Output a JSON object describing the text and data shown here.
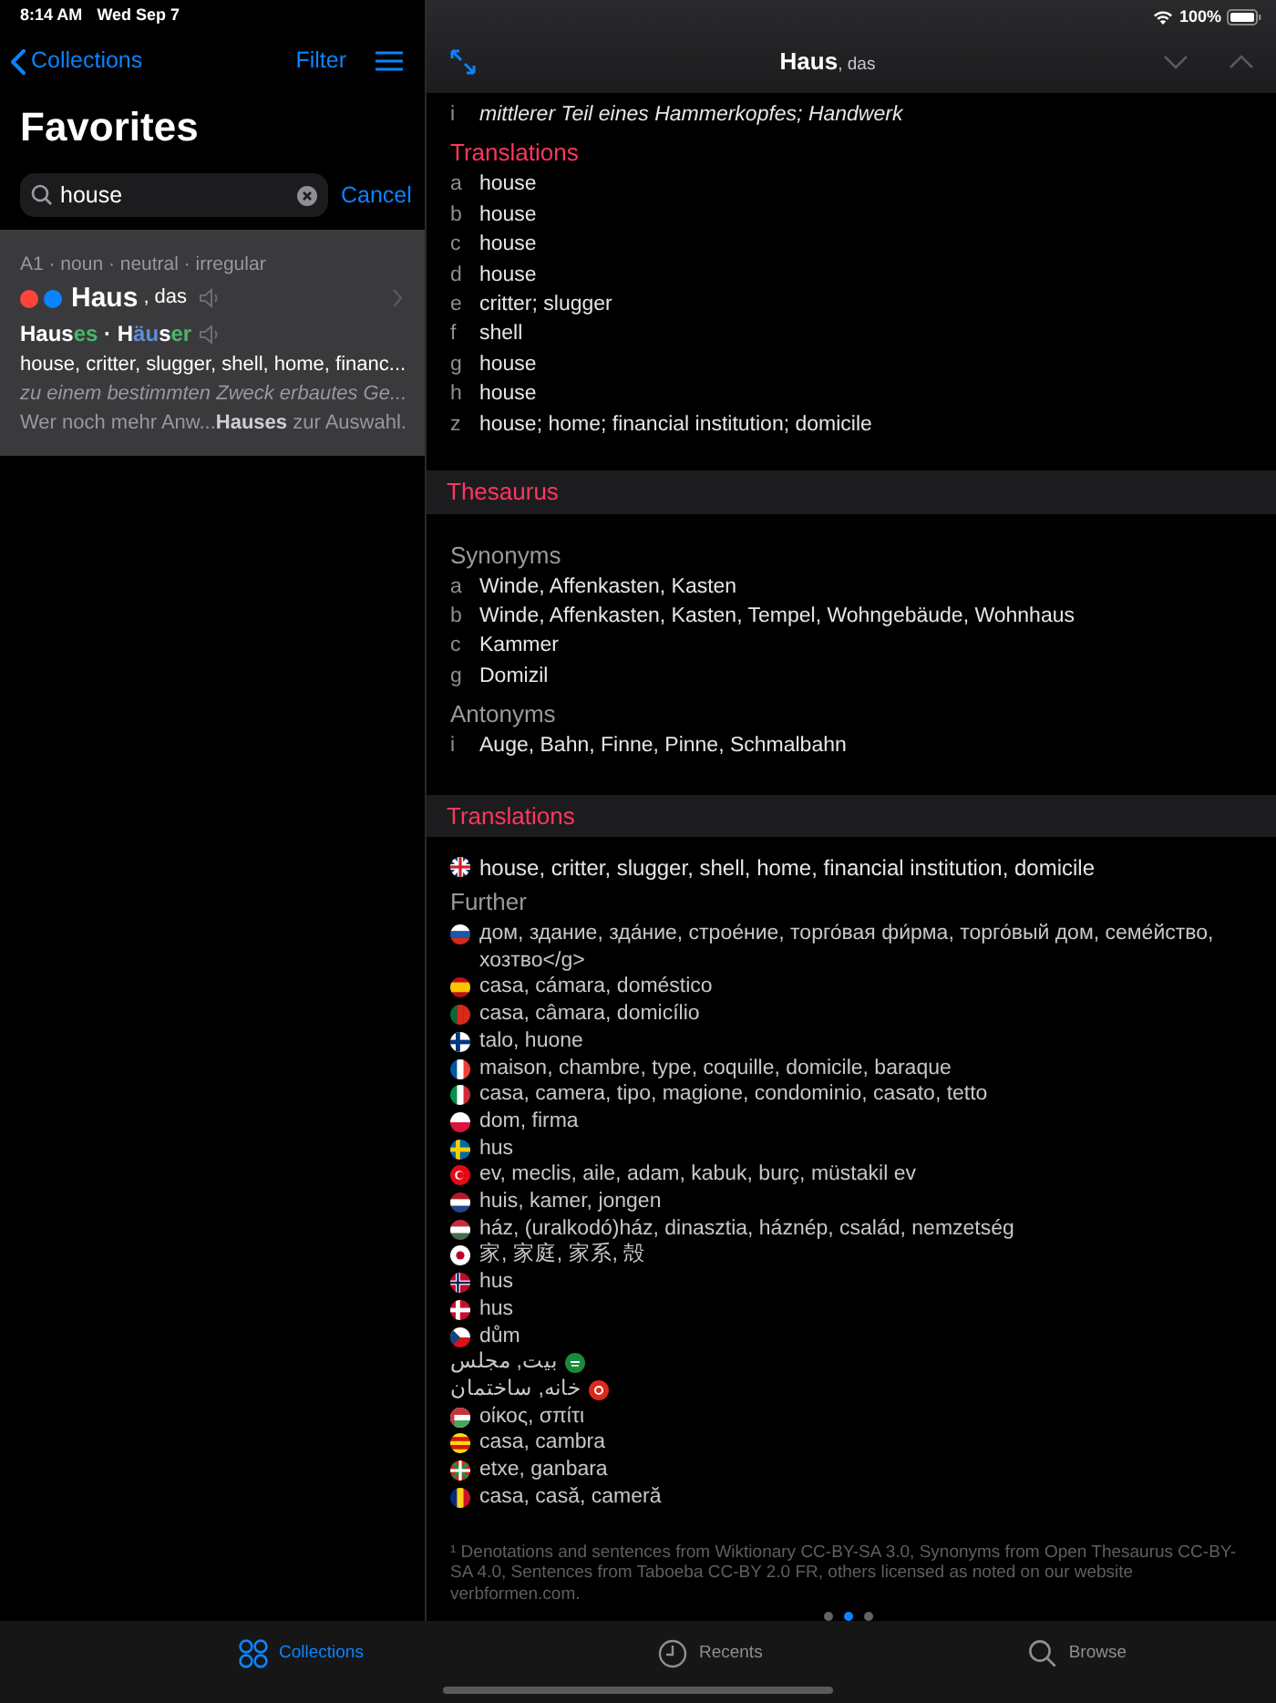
{
  "status_bar": {
    "time": "8:14 AM",
    "date": "Wed Sep 7",
    "battery": "100%"
  },
  "sidebar": {
    "back": "Collections",
    "filter": "Filter",
    "title": "Favorites",
    "search": {
      "value": "house"
    },
    "cancel": "Cancel",
    "result": {
      "meta": "A1 · noun · neutral · irregular",
      "dots": [
        {
          "color": "#ff453a"
        },
        {
          "color": "#0a84ff"
        }
      ],
      "word": "Haus",
      "article": ", das",
      "forms": [
        {
          "text": "Haus",
          "kind": "stem"
        },
        {
          "text": "es",
          "kind": "ending"
        },
        {
          "text": " · ",
          "kind": "stem"
        },
        {
          "text": "H",
          "kind": "stem"
        },
        {
          "text": "äu",
          "kind": "umlaut"
        },
        {
          "text": "s",
          "kind": "stem"
        },
        {
          "text": "er",
          "kind": "ending"
        }
      ],
      "translations": "house, critter, slugger, shell, home, financ...",
      "definition": "zu einem bestimmten Zweck erbautes Ge...",
      "sentence": "Wer noch mehr Anw...**Hauses** zur Auswahl."
    }
  },
  "detail": {
    "title": "Haus",
    "article": ", das",
    "meaning": {
      "letter": "i",
      "text": "mittlerer Teil eines Hammerkopfes; Handwerk"
    },
    "translations_heading": "Translations",
    "translations": [
      {
        "letter": "a",
        "text": "house"
      },
      {
        "letter": "b",
        "text": "house"
      },
      {
        "letter": "c",
        "text": "house"
      },
      {
        "letter": "d",
        "text": "house"
      },
      {
        "letter": "e",
        "text": "critter; slugger"
      },
      {
        "letter": "f",
        "text": "shell"
      },
      {
        "letter": "g",
        "text": "house"
      },
      {
        "letter": "h",
        "text": "house"
      },
      {
        "letter": "z",
        "text": "house; home; financial institution; domicile"
      }
    ],
    "thesaurus": {
      "heading": "Thesaurus",
      "synonyms_label": "Synonyms",
      "synonyms": [
        {
          "letter": "a",
          "text": "Winde, Affenkasten, Kasten"
        },
        {
          "letter": "b",
          "text": "Winde, Affenkasten, Kasten, Tempel, Wohngebäude, Wohnhaus"
        },
        {
          "letter": "c",
          "text": "Kammer"
        },
        {
          "letter": "g",
          "text": "Domizil"
        }
      ],
      "antonyms_label": "Antonyms",
      "antonyms": [
        {
          "letter": "i",
          "text": "Auge, Bahn, Finne, Pinne, Schmalbahn"
        }
      ]
    },
    "languages": {
      "heading": "Translations",
      "main": {
        "kind": "gb",
        "text": "house, critter, slugger, shell, home, financial institution, domicile"
      },
      "further_label": "Further",
      "further": [
        {
          "kind": "ru",
          "text": "дом, здание, зда́ние, строе́ние, торго́вая фи́рма, торго́вый дом, семе́йство, хозтво</g>"
        },
        {
          "kind": "es",
          "text": "casa, cámara, doméstico"
        },
        {
          "kind": "pt",
          "text": "casa, câmara, domicílio"
        },
        {
          "kind": "fi",
          "text": "talo, huone"
        },
        {
          "kind": "fr",
          "text": "maison, chambre, type, coquille, domicile, baraque"
        },
        {
          "kind": "it",
          "text": "casa, camera, tipo, magione, condominio, casato, tetto"
        },
        {
          "kind": "pl",
          "text": "dom, firma"
        },
        {
          "kind": "se",
          "text": "hus"
        },
        {
          "kind": "tr",
          "text": "ev, meclis, aile, adam, kabuk, burç, müstakil ev"
        },
        {
          "kind": "nl",
          "text": "huis, kamer, jongen"
        },
        {
          "kind": "hu",
          "text": "ház, (uralkodó)ház, dinasztia, háznép, család, nemzetség"
        },
        {
          "kind": "jp",
          "text": "家, 家庭, 家系, 殻"
        },
        {
          "kind": "no",
          "text": "hus"
        },
        {
          "kind": "dk",
          "text": "hus"
        },
        {
          "kind": "cz",
          "text": "dům"
        },
        {
          "kind": "ar",
          "text": "بيت, مجلس"
        },
        {
          "kind": "fa",
          "text": "خانه, ساختمان"
        },
        {
          "kind": "el",
          "text": "οίκος, σπίτι"
        },
        {
          "kind": "ca",
          "text": "casa, cambra"
        },
        {
          "kind": "eu",
          "text": "etxe, ganbara"
        },
        {
          "kind": "ro",
          "text": "casa, casă, cameră"
        }
      ]
    },
    "footnote": "¹ Denotations and sentences from Wiktionary CC-BY-SA 3.0, Synonyms from Open Thesaurus CC-BY-SA 4.0, Sentences from Taboeba CC-BY 2.0 FR, others licensed as noted on our website verbformen.com.",
    "pages": [
      {
        "selected": false
      },
      {
        "selected": true
      },
      {
        "selected": false
      }
    ]
  },
  "tab_bar": [
    {
      "label": "Collections",
      "selected": true
    },
    {
      "label": "Recents",
      "selected": false
    },
    {
      "label": "Browse",
      "selected": false
    }
  ]
}
